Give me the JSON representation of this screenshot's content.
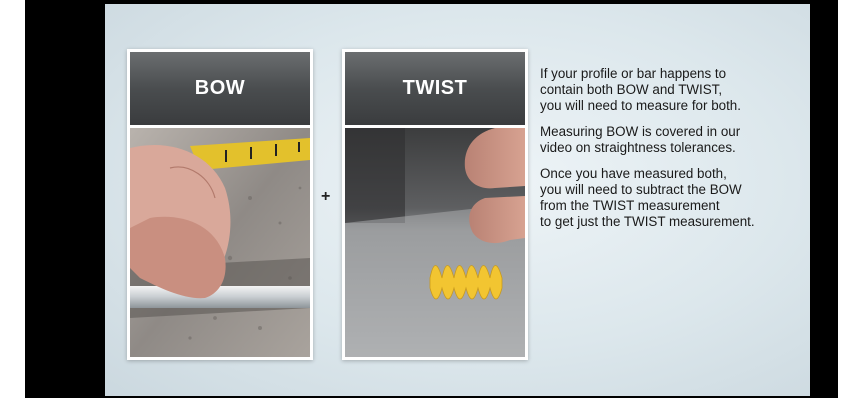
{
  "slide": {
    "cards": [
      {
        "title": "BOW"
      },
      {
        "title": "TWIST"
      }
    ],
    "plus": "+",
    "paragraphs": [
      "If your profile or bar happens to\ncontain both BOW and TWIST,\nyou will need to measure for both.",
      "Measuring BOW is covered in our\nvideo on straightness tolerances.",
      "Once you have measured both,\nyou will need to subtract the BOW\nfrom the TWIST measurement\nto get just the TWIST measurement."
    ],
    "colors": {
      "letterbox": "#000000",
      "card_header": "#4a4d4f",
      "twist_part": "#f2c531",
      "tape": "#e3c12c"
    }
  }
}
